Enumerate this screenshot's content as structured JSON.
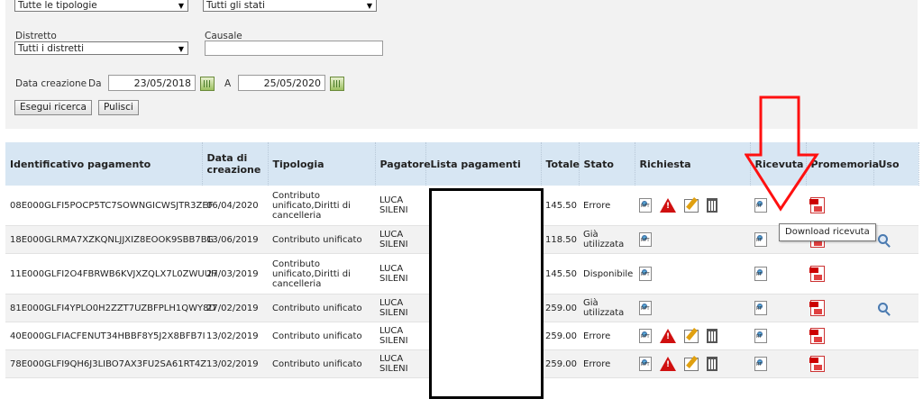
{
  "filters": {
    "tipologia": "Tutte le tipologie",
    "stato": "Tutti gli stati",
    "distretto_label": "Distretto",
    "distretto": "Tutti i distretti",
    "causale_label": "Causale",
    "causale_value": "",
    "data_creazione_label": "Data creazione",
    "da_label": "Da",
    "da_value": "23/05/2018",
    "a_label": "A",
    "a_value": "25/05/2020",
    "search_button": "Esegui ricerca",
    "clear_button": "Pulisci"
  },
  "table": {
    "headers": [
      "Identificativo pagamento",
      "Data di creazione",
      "Tipologia",
      "Pagatore",
      "Lista pagamenti",
      "Totale",
      "Stato",
      "Richiesta",
      "Ricevuta",
      "Promemoria",
      "Uso"
    ],
    "rows": [
      {
        "id": "08E000GLFI5POCP5TC7SOWNGICWSJTR3ZEF",
        "data": "06/04/2020",
        "tipologia": "Contributo unificato,Diritti di cancelleria",
        "pagatore": "LUCA SILENI",
        "totale": "145.50",
        "stato": "Errore"
      },
      {
        "id": "18E000GLRMA7XZKQNLJJXIZ8EOOK9SBB7BG",
        "data": "13/06/2019",
        "tipologia": "Contributo unificato",
        "pagatore": "LUCA SILENI",
        "totale": "118.50",
        "stato": "Già utilizzata"
      },
      {
        "id": "11E000GLFI2O4FBRWB6KVJXZQLX7L0ZWUUH",
        "data": "27/03/2019",
        "tipologia": "Contributo unificato,Diritti di cancelleria",
        "pagatore": "LUCA SILENI",
        "totale": "145.50",
        "stato": "Disponibile"
      },
      {
        "id": "81E000GLFI4YPLO0H2ZZT7UZBFPLH1QWY8D",
        "data": "27/02/2019",
        "tipologia": "Contributo unificato",
        "pagatore": "LUCA SILENI",
        "totale": "259.00",
        "stato": "Già utilizzata"
      },
      {
        "id": "40E000GLFIACFENUT34HBBF8Y5J2X8BFB7I",
        "data": "13/02/2019",
        "tipologia": "Contributo unificato",
        "pagatore": "LUCA SILENI",
        "totale": "259.00",
        "stato": "Errore"
      },
      {
        "id": "78E000GLFI9QH6J3LIBO7AX3FU2SA61RT4Z",
        "data": "13/02/2019",
        "tipologia": "Contributo unificato",
        "pagatore": "LUCA SILENI",
        "totale": "259.00",
        "stato": "Errore"
      }
    ]
  },
  "tooltip": "Download ricevuta",
  "icons": {
    "rpt": "RPT",
    "rt": "RT"
  },
  "colors": {
    "header_bg": "#d7e6f3",
    "annotation_red": "#ff0000",
    "alt_row": "#f2f2f2"
  }
}
